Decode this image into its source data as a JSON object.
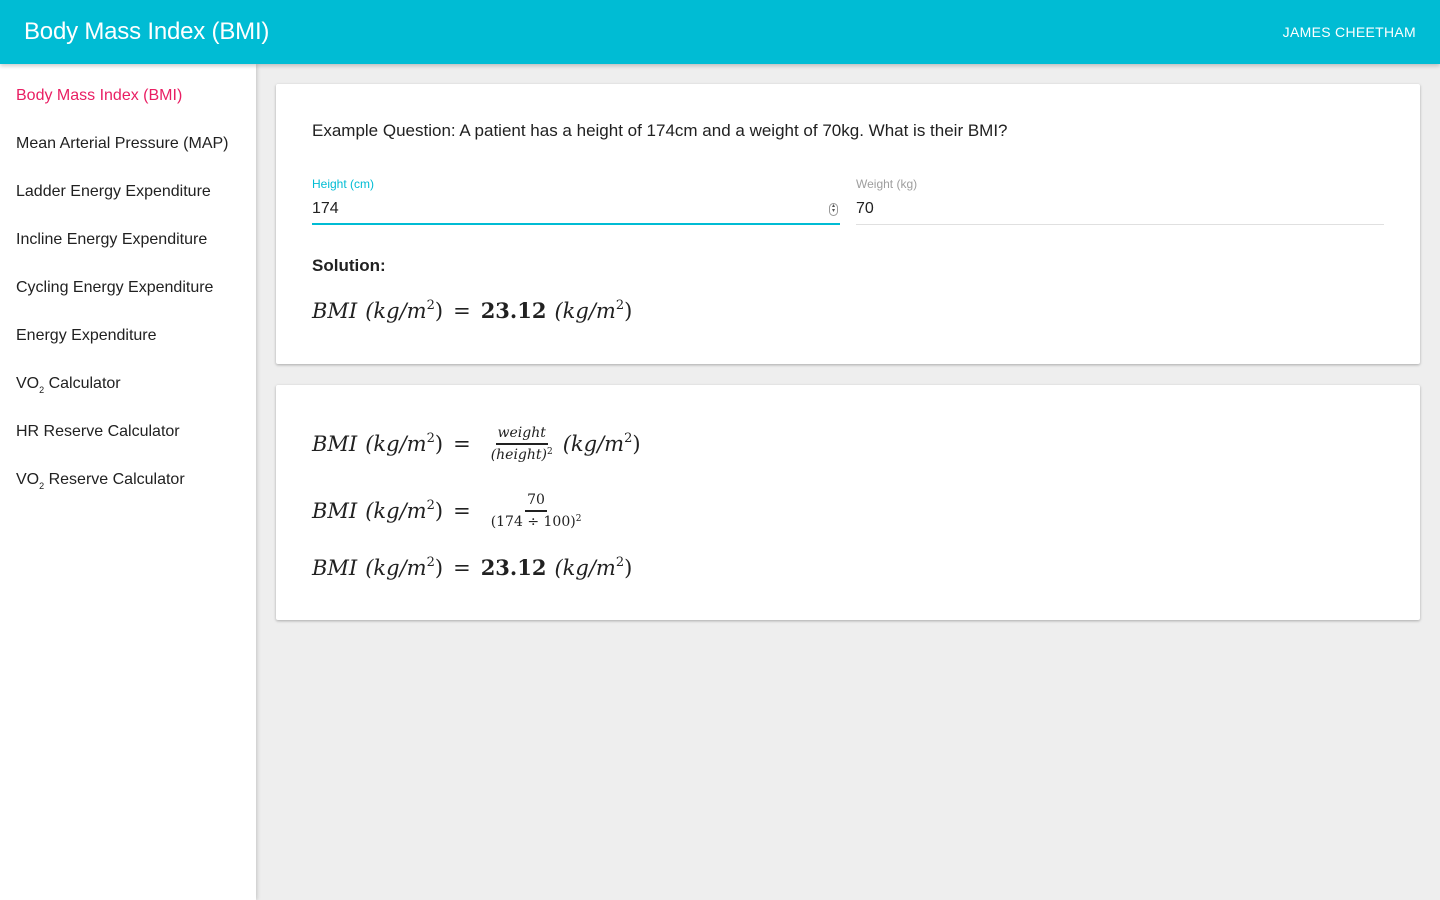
{
  "appbar": {
    "title": "Body Mass Index (BMI)",
    "user": "JAMES CHEETHAM"
  },
  "sidebar": {
    "items": [
      {
        "label": "Body Mass Index (BMI)",
        "active": true
      },
      {
        "label": "Mean Arterial Pressure (MAP)"
      },
      {
        "label": "Ladder Energy Expenditure"
      },
      {
        "label": "Incline Energy Expenditure"
      },
      {
        "label": "Cycling Energy Expenditure"
      },
      {
        "label": "Energy Expenditure"
      },
      {
        "label_prefix": "VO",
        "label_sub": "2",
        "label_suffix": " Calculator"
      },
      {
        "label": "HR Reserve Calculator"
      },
      {
        "label_prefix": "VO",
        "label_sub": "2",
        "label_suffix": " Reserve Calculator"
      }
    ]
  },
  "question": "Example Question: A patient has a height of 174cm and a weight of 70kg. What is their BMI?",
  "form": {
    "height": {
      "label": "Height (cm)",
      "value": "174"
    },
    "weight": {
      "label": "Weight (kg)",
      "value": "70"
    }
  },
  "solution": {
    "label": "Solution:",
    "lhs_var": "BMI",
    "lhs_unit_open": "(kg/m",
    "unit_power": "2",
    "unit_close": ")",
    "equals": "=",
    "result": "23.12",
    "formula_numerator": "weight",
    "formula_denominator": "(height)",
    "denominator_power": "2",
    "sub_numerator": "70",
    "sub_denominator": "(174 ÷ 100)"
  },
  "colors": {
    "primary": "#00bcd4",
    "accent": "#e91e63"
  }
}
